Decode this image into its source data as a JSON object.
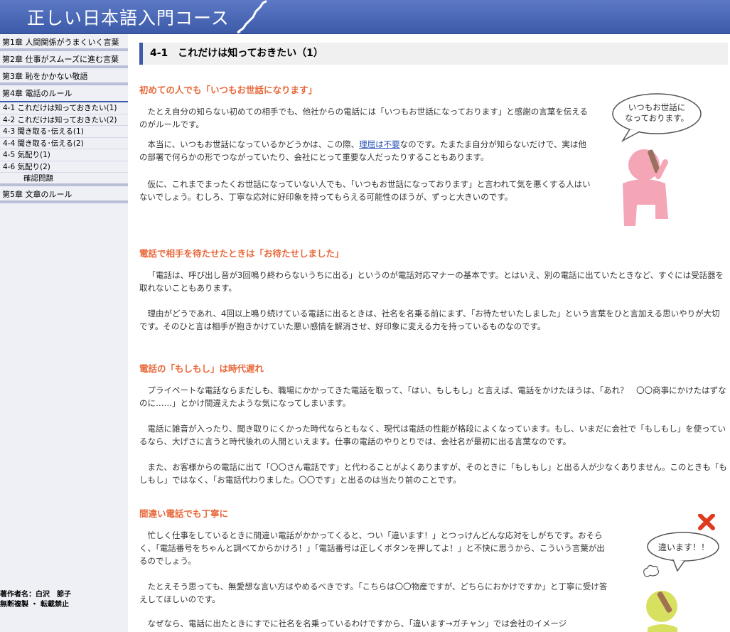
{
  "header": {
    "title": "正しい日本語入門コース"
  },
  "sidebar": {
    "chapters": [
      {
        "label": "第1章  人間関係がうまくいく言葉"
      },
      {
        "label": "第2章  仕事がスムーズに進む言葉"
      },
      {
        "label": "第3章  恥をかかない敬語"
      },
      {
        "label": "第4章  電話のルール"
      }
    ],
    "subitems": [
      {
        "label": "4-1  これだけは知っておきたい(1)"
      },
      {
        "label": "4-2  これだけは知っておきたい(2)"
      },
      {
        "label": "4-3  聞き取る･伝える(1)"
      },
      {
        "label": "4-4  聞き取る･伝える(2)"
      },
      {
        "label": "4-5  気配り(1)"
      },
      {
        "label": "4-6  気配り(2)"
      },
      {
        "label": "確認問題"
      }
    ],
    "chapter5": "第5章  文章のルール",
    "author": "著作者名：白沢　節子",
    "copyright": "無断複製 ・ 転載禁止"
  },
  "main": {
    "page_heading": "4-1　これだけは知っておきたい（1）",
    "sections": [
      {
        "title": "初めての人でも「いつもお世話になります」",
        "paragraphs": [
          "たとえ自分の知らない初めての相手でも、他社からの電話には「いつもお世話になっております」と感謝の言葉を伝えるのがルールです。",
          "本当に、いつもお世話になっているかどうかは、この際、",
          "理屈は不要",
          "なのです。たまたま自分が知らないだけで、実は他の部署で何らかの形でつながっていたり、会社にとって重要な人だったりすることもあります。",
          "仮に、これまでまったくお世話になっていない人でも、「いつもお世話になっております」と言われて気を悪くする人はいないでしょう。むしろ、丁寧な応対に好印象を持ってもらえる可能性のほうが、ずっと大きいのです。"
        ],
        "bubble_line1": "いつもお世話に",
        "bubble_line2": "なっております。"
      },
      {
        "title": "電話で相手を待たせたときは「お待たせしました」",
        "paragraphs": [
          "「電話は、呼び出し音が3回鳴り終わらないうちに出る」というのが電話対応マナーの基本です。とはいえ、別の電話に出ていたときなど、すぐには受話器を取れないこともあります。",
          "理由がどうであれ、4回以上鳴り続けている電話に出るときは、社名を名乗る前にまず、「お待たせいたしました」という言葉をひと言加える思いやりが大切です。そのひと言は相手が抱きかけていた悪い感情を解消させ、好印象に変える力を持っているものなのです。"
        ]
      },
      {
        "title": "電話の「もしもし」は時代遅れ",
        "paragraphs": [
          "プライベートな電話ならまだしも、職場にかかってきた電話を取って、「はい、もしもし」と言えば、電話をかけたほうは、「あれ？　〇〇商事にかけたはずなのに……」とかけ間違えたような気になってしまいます。",
          "電話に雑音が入ったり、聞き取りにくかった時代ならともなく、現代は電話の性能が格段によくなっています。もし、いまだに会社で「もしもし」を使っているなら、大げさに言うと時代後れの人間といえます。仕事の電話のやりとりでは、会社名が最初に出る言葉なのです。",
          "また、お客様からの電話に出て「〇〇さん電話です」と代わることがよくありますが、そのときに「もしもし」と出る人が少なくありません。このときも「もしもし」ではなく、「お電話代わりました。〇〇です」と出るのは当たり前のことです。"
        ]
      },
      {
        "title": "間違い電話でも丁寧に",
        "paragraphs": [
          "忙しく仕事をしているときに間違い電話がかかってくると、つい「違います！」とつっけんどんな応対をしがちです。おそらく、「電話番号をちゃんと調べてからかけろ！」「電話番号は正しくボタンを押してよ！」と不快に思うから、こういう言葉が出るのでしょう。",
          "たとえそう思っても、無愛想な言い方はやめるべきです。「こちらは〇〇物産ですが、どちらにおかけですか」と丁寧に受け答えしてほしいのです。",
          "なぜなら、電話に出たときにすでに社名を名乗っているわけですから、「違います→ガチャン」では会社のイメージ"
        ],
        "bubble": "違います！！"
      }
    ]
  },
  "colors": {
    "accent": "#3d5aa8",
    "section_title": "#e8683a",
    "link": "#2451b8"
  }
}
